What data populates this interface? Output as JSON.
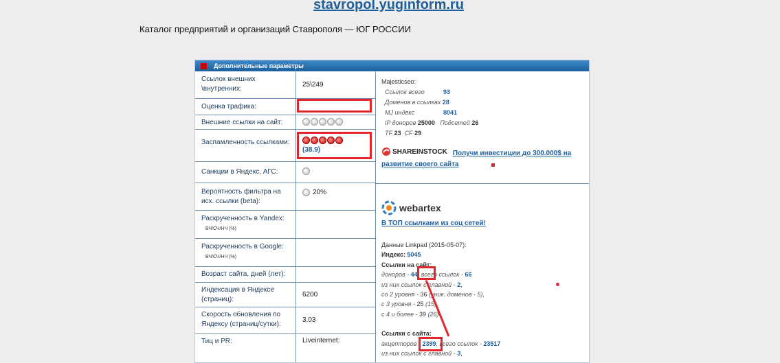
{
  "header": {
    "site": "stavropol.yuginform.ru",
    "subtitle": "Каталог предприятий и организаций Ставрополя — ЮГ РОССИИ"
  },
  "panel": {
    "title": "Дополнительные параметры",
    "rows": [
      {
        "label": "Ссылок внешних \\внутренних:",
        "value": "25\\249"
      },
      {
        "label": "Оценка трафика:",
        "value": ""
      },
      {
        "label": "Внешние ссылки на сайт:",
        "value": ""
      },
      {
        "label": "Заспамленность ссылками:",
        "value": "(38.9)"
      },
      {
        "label": "Санкции в Яндекс, АГС:",
        "value": ""
      },
      {
        "label": "Вероятность фильтра на исх. ссылки (beta):",
        "value": "20%"
      },
      {
        "label": "Раскрученность в Yandex:",
        "sub": "ВЧ/СЧ/НЧ (%)",
        "value": ""
      },
      {
        "label": "Раскрученность в Google:",
        "sub": "ВЧ/СЧ/НЧ (%)",
        "value": ""
      },
      {
        "label": "Возраст сайта, дней (лет):",
        "value": ""
      },
      {
        "label": "Индексация в Яндексе (страниц):",
        "value": "6200"
      },
      {
        "label": "Скорость обновления по Яндексу (страниц/сутки):",
        "value": "3.03"
      },
      {
        "label": "Тиц и PR:",
        "value": "Liveinternet:"
      }
    ],
    "ratings": {
      "external_links": {
        "filled": 0,
        "total": 5
      },
      "spam": {
        "filled": 5,
        "total": 5
      }
    }
  },
  "majestic": {
    "title": "Majesticseo:",
    "links_total_label": "Ссылок всего",
    "links_total": "93",
    "domains_label": "Доменов в ссылках",
    "domains": "28",
    "mj_label": "MJ индекс",
    "mj": "8041",
    "ip_label": "IP доноров",
    "ip": "25000",
    "subnets_label": "Подсетей",
    "subnets": "26",
    "tf_label": "TF",
    "tf": "23",
    "cf_label": "CF",
    "cf": "29"
  },
  "shareinstock": {
    "logo": "SHAREINSTOCK",
    "link": "Получи инвестиции до 300.000$ на развитие своего сайта"
  },
  "webartex": {
    "logo": "webartex",
    "link": "В ТОП ссылками из соц сетей!"
  },
  "linkpad": {
    "title": "Данные Linkpad (2015-05-07):",
    "index_label": "Индекс:",
    "index": "5045",
    "links_label": "Ссылки на сайт:",
    "donors_label": "доноров -",
    "donors": "44",
    "all_links_label": ", всего ссылок -",
    "all_links": "66",
    "line1": "из них ссылок с главной -",
    "line1_val": "2",
    "line2": "со 2 уровня -",
    "line2_val": "36",
    "line2_extra": "(уник. доменов - 5),",
    "line3": "с 3 уровня -",
    "line3_val": "25",
    "line3_extra": "(15),",
    "line4": "с 4 и более -",
    "line4_val": "39",
    "line4_extra": "(26)",
    "from_label": "Ссылки с сайта:",
    "acceptors_label": "акцепторов -",
    "acceptors": "2399",
    "acc_links_label": ", всего ссылок -",
    "acc_links": "23517",
    "acc_line1": "из них ссылок с главной -",
    "acc_line1_val": "3"
  }
}
